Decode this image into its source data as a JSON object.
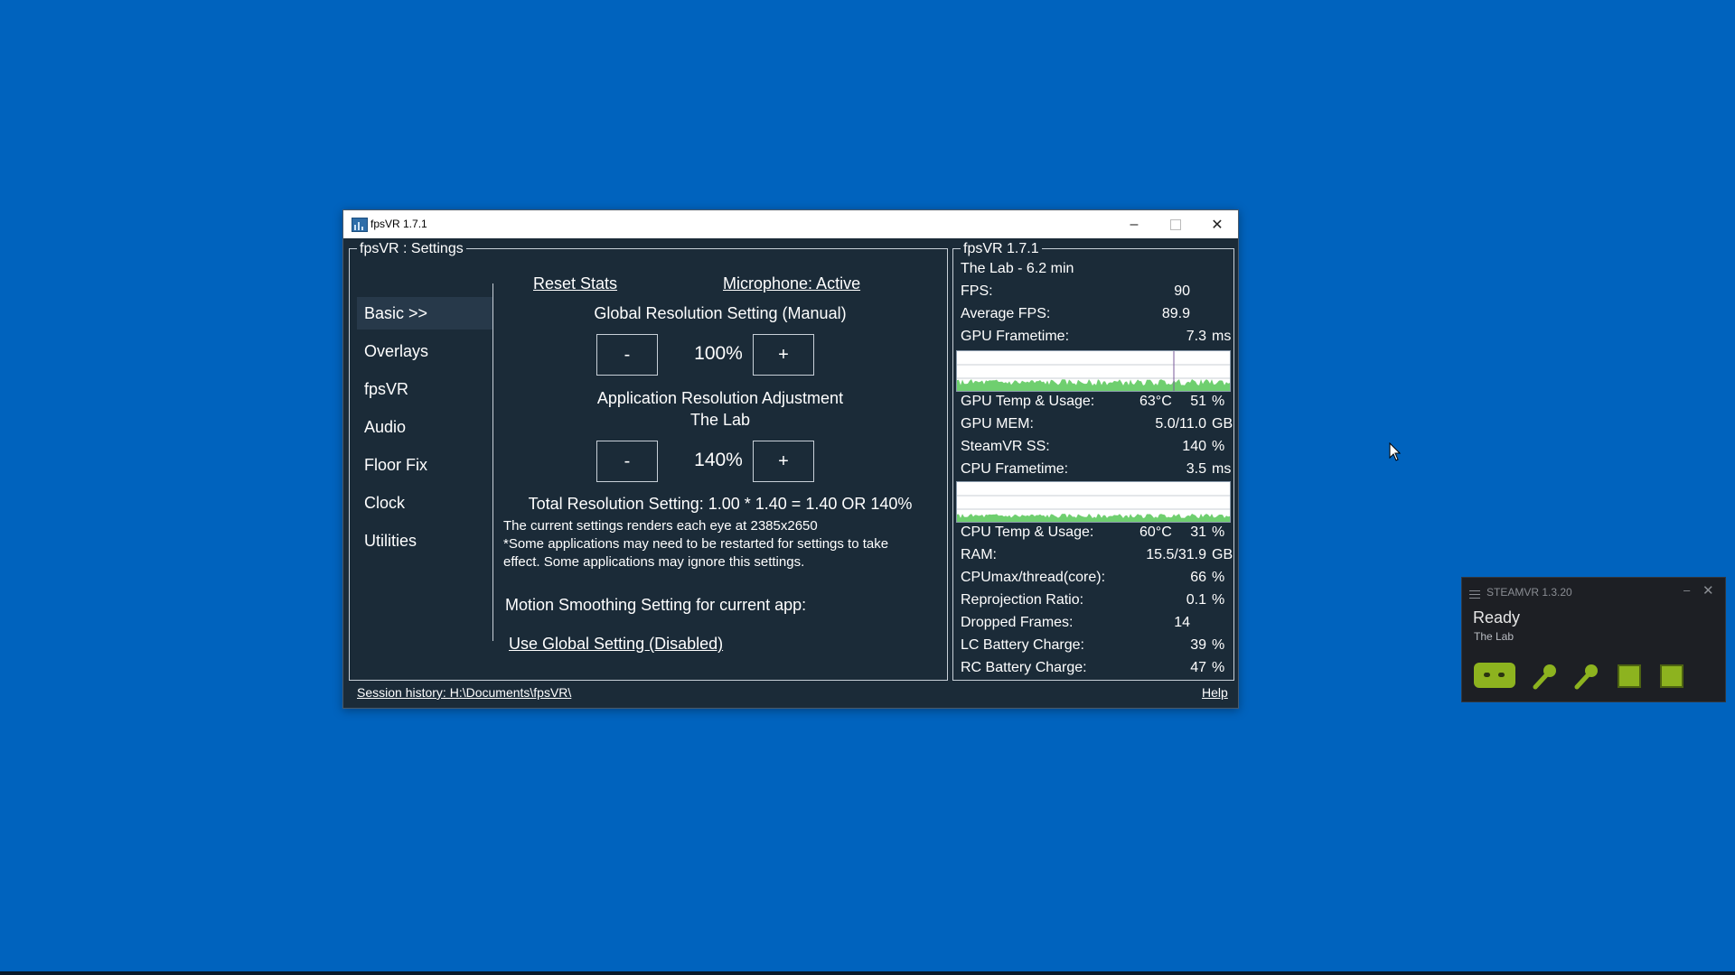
{
  "window": {
    "title": "fpsVR 1.7.1",
    "minimize": "–",
    "close": "✕"
  },
  "settings": {
    "legend": "fpsVR : Settings",
    "nav": [
      "Basic >>",
      "Overlays",
      "fpsVR",
      "Audio",
      "Floor Fix",
      "Clock",
      "Utilities"
    ],
    "active_nav_index": 0,
    "reset_stats": "Reset Stats",
    "microphone": "Microphone: Active",
    "global_res_title": "Global Resolution Setting (Manual)",
    "global_res_value": "100%",
    "app_res_title": "Application Resolution Adjustment",
    "app_name": "The Lab",
    "app_res_value": "140%",
    "minus": "-",
    "plus": "+",
    "total_res": "Total Resolution Setting: 1.00 * 1.40 = 1.40 OR 140%",
    "render_info": "The current settings renders each eye at 2385x2650",
    "restart_note_1": "*Some applications may need to be restarted for settings to take",
    "restart_note_2": "effect. Some applications may ignore this settings.",
    "motion_title": "Motion Smoothing Setting for current app:",
    "motion_value": "Use Global Setting (Disabled)"
  },
  "stats": {
    "legend": "fpsVR 1.7.1",
    "session": "The Lab - 6.2 min",
    "fps_label": "FPS:",
    "fps_value": "90",
    "avg_fps_label": "Average FPS:",
    "avg_fps_value": "89.9",
    "gpu_ft_label": "GPU Frametime:",
    "gpu_ft_value": "7.3",
    "gpu_ft_unit": "ms",
    "gpu_temp_label": "GPU Temp & Usage:",
    "gpu_temp": "63°C",
    "gpu_usage": "51",
    "gpu_usage_unit": "%",
    "gpu_mem_label": "GPU MEM:",
    "gpu_mem_value": "5.0/11.0",
    "gpu_mem_unit": "GB",
    "ss_label": "SteamVR SS:",
    "ss_value": "140",
    "ss_unit": "%",
    "cpu_ft_label": "CPU Frametime:",
    "cpu_ft_value": "3.5",
    "cpu_ft_unit": "ms",
    "cpu_temp_label": "CPU Temp & Usage:",
    "cpu_temp": "60°C",
    "cpu_usage": "31",
    "cpu_usage_unit": "%",
    "ram_label": "RAM:",
    "ram_value": "15.5/31.9",
    "ram_unit": "GB",
    "cpumax_label": "CPUmax/thread(core):",
    "cpumax_value": "66",
    "cpumax_unit": "%",
    "reproj_label": "Reprojection Ratio:",
    "reproj_value": "0.1",
    "reproj_unit": "%",
    "dropped_label": "Dropped Frames:",
    "dropped_value": "14",
    "lc_label": "LC Battery Charge:",
    "lc_value": "39",
    "lc_unit": "%",
    "rc_label": "RC Battery Charge:",
    "rc_value": "47",
    "rc_unit": "%"
  },
  "footer": {
    "session_history": "Session history: H:\\Documents\\fpsVR\\",
    "help": "Help"
  },
  "steamvr": {
    "title": "STEAMVR 1.3.20",
    "minimize": "–",
    "close": "✕",
    "status": "Ready",
    "app": "The Lab",
    "devices": [
      "headset-icon",
      "controller-left-icon",
      "controller-right-icon",
      "base-station-1-icon",
      "base-station-2-icon"
    ]
  },
  "colors": {
    "desktop": "#0063be",
    "window_bg": "#1b2b38",
    "graph_fill": "#6fcf6f",
    "steamvr_green": "#8db31f"
  }
}
